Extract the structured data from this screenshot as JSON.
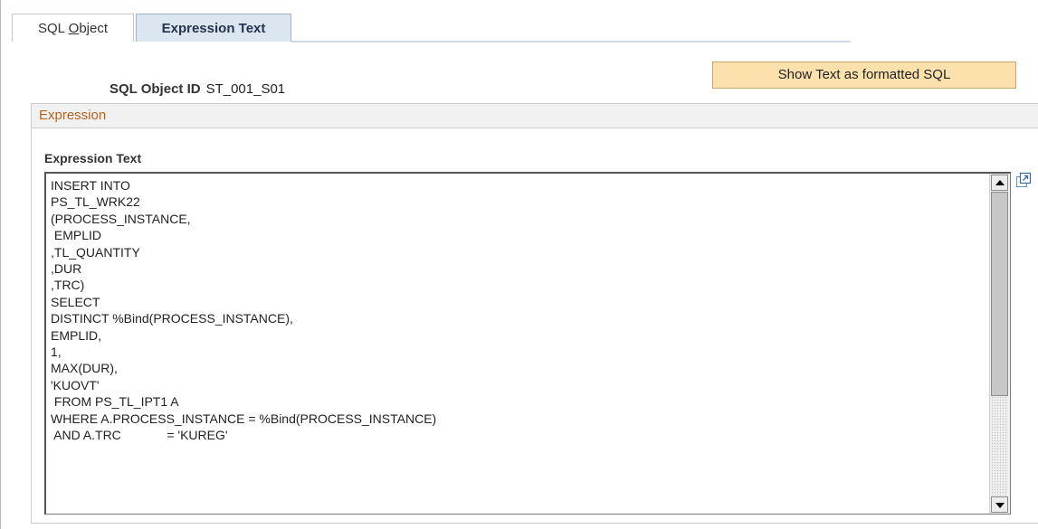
{
  "tabs": [
    {
      "label_prefix": "SQL ",
      "label_underlined": "O",
      "label_suffix": "bject"
    },
    {
      "label": "Expression Text"
    }
  ],
  "show_button_label": "Show Text as formatted SQL",
  "sql_object": {
    "label": "SQL Object ID",
    "value": "ST_001_S01"
  },
  "group": {
    "title": "Expression"
  },
  "expression_label": "Expression Text",
  "expression_lines": [
    "INSERT INTO",
    "PS_TL_WRK22",
    "(PROCESS_INSTANCE,",
    " EMPLID",
    ",TL_QUANTITY",
    ",DUR",
    ",TRC)",
    "SELECT",
    "DISTINCT %Bind(PROCESS_INSTANCE),",
    "EMPLID,",
    "1,",
    "MAX(DUR),",
    "'KUOVT'",
    " FROM PS_TL_IPT1 A",
    "WHERE A.PROCESS_INSTANCE = %Bind(PROCESS_INSTANCE)",
    " AND A.TRC             = 'KUREG'"
  ],
  "icons": {
    "expand": "expand-icon",
    "scroll_up": "scroll-up-arrow-icon",
    "scroll_down": "scroll-down-arrow-icon"
  },
  "colors": {
    "active_tab_bg": "#dbe6f1",
    "button_bg": "#fde1ad",
    "group_title": "#b8621b"
  }
}
